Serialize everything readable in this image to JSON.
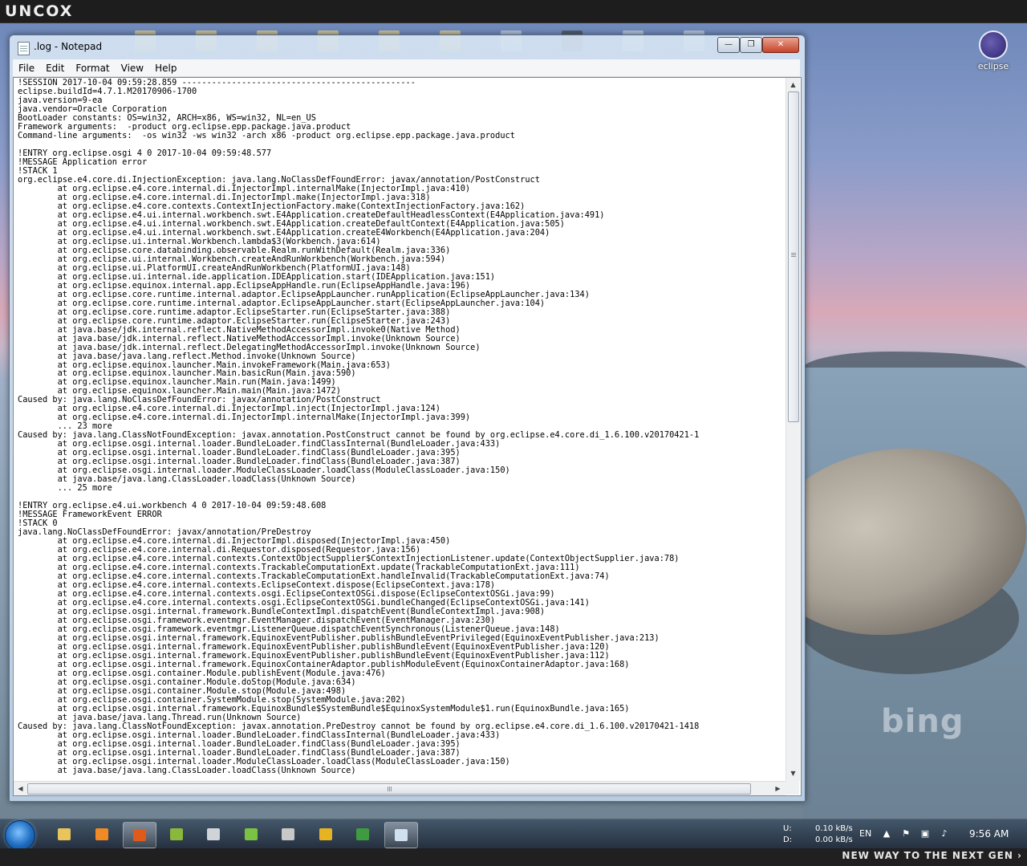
{
  "top_bar": {
    "brand": "UNCOX"
  },
  "bottom_bar": {
    "tagline": "NEW WAY TO THE NEXT GEN ›"
  },
  "desktop": {
    "eclipse_icon_label": "eclipse",
    "bing_watermark": "bing"
  },
  "window": {
    "title": ".log - Notepad",
    "buttons": {
      "minimize": "—",
      "maximize": "❐",
      "close": "✕"
    },
    "menu": [
      "File",
      "Edit",
      "Format",
      "View",
      "Help"
    ],
    "content": [
      "!SESSION 2017-10-04 09:59:28.859 -----------------------------------------------",
      "eclipse.buildId=4.7.1.M20170906-1700",
      "java.version=9-ea",
      "java.vendor=Oracle Corporation",
      "BootLoader constants: OS=win32, ARCH=x86, WS=win32, NL=en_US",
      "Framework arguments:  -product org.eclipse.epp.package.java.product",
      "Command-line arguments:  -os win32 -ws win32 -arch x86 -product org.eclipse.epp.package.java.product",
      "",
      "!ENTRY org.eclipse.osgi 4 0 2017-10-04 09:59:48.577",
      "!MESSAGE Application error",
      "!STACK 1",
      "org.eclipse.e4.core.di.InjectionException: java.lang.NoClassDefFoundError: javax/annotation/PostConstruct",
      "        at org.eclipse.e4.core.internal.di.InjectorImpl.internalMake(InjectorImpl.java:410)",
      "        at org.eclipse.e4.core.internal.di.InjectorImpl.make(InjectorImpl.java:318)",
      "        at org.eclipse.e4.core.contexts.ContextInjectionFactory.make(ContextInjectionFactory.java:162)",
      "        at org.eclipse.e4.ui.internal.workbench.swt.E4Application.createDefaultHeadlessContext(E4Application.java:491)",
      "        at org.eclipse.e4.ui.internal.workbench.swt.E4Application.createDefaultContext(E4Application.java:505)",
      "        at org.eclipse.e4.ui.internal.workbench.swt.E4Application.createE4Workbench(E4Application.java:204)",
      "        at org.eclipse.ui.internal.Workbench.lambda$3(Workbench.java:614)",
      "        at org.eclipse.core.databinding.observable.Realm.runWithDefault(Realm.java:336)",
      "        at org.eclipse.ui.internal.Workbench.createAndRunWorkbench(Workbench.java:594)",
      "        at org.eclipse.ui.PlatformUI.createAndRunWorkbench(PlatformUI.java:148)",
      "        at org.eclipse.ui.internal.ide.application.IDEApplication.start(IDEApplication.java:151)",
      "        at org.eclipse.equinox.internal.app.EclipseAppHandle.run(EclipseAppHandle.java:196)",
      "        at org.eclipse.core.runtime.internal.adaptor.EclipseAppLauncher.runApplication(EclipseAppLauncher.java:134)",
      "        at org.eclipse.core.runtime.internal.adaptor.EclipseAppLauncher.start(EclipseAppLauncher.java:104)",
      "        at org.eclipse.core.runtime.adaptor.EclipseStarter.run(EclipseStarter.java:388)",
      "        at org.eclipse.core.runtime.adaptor.EclipseStarter.run(EclipseStarter.java:243)",
      "        at java.base/jdk.internal.reflect.NativeMethodAccessorImpl.invoke0(Native Method)",
      "        at java.base/jdk.internal.reflect.NativeMethodAccessorImpl.invoke(Unknown Source)",
      "        at java.base/jdk.internal.reflect.DelegatingMethodAccessorImpl.invoke(Unknown Source)",
      "        at java.base/java.lang.reflect.Method.invoke(Unknown Source)",
      "        at org.eclipse.equinox.launcher.Main.invokeFramework(Main.java:653)",
      "        at org.eclipse.equinox.launcher.Main.basicRun(Main.java:590)",
      "        at org.eclipse.equinox.launcher.Main.run(Main.java:1499)",
      "        at org.eclipse.equinox.launcher.Main.main(Main.java:1472)",
      "Caused by: java.lang.NoClassDefFoundError: javax/annotation/PostConstruct",
      "        at org.eclipse.e4.core.internal.di.InjectorImpl.inject(InjectorImpl.java:124)",
      "        at org.eclipse.e4.core.internal.di.InjectorImpl.internalMake(InjectorImpl.java:399)",
      "        ... 23 more",
      "Caused by: java.lang.ClassNotFoundException: javax.annotation.PostConstruct cannot be found by org.eclipse.e4.core.di_1.6.100.v20170421-1",
      "        at org.eclipse.osgi.internal.loader.BundleLoader.findClassInternal(BundleLoader.java:433)",
      "        at org.eclipse.osgi.internal.loader.BundleLoader.findClass(BundleLoader.java:395)",
      "        at org.eclipse.osgi.internal.loader.BundleLoader.findClass(BundleLoader.java:387)",
      "        at org.eclipse.osgi.internal.loader.ModuleClassLoader.loadClass(ModuleClassLoader.java:150)",
      "        at java.base/java.lang.ClassLoader.loadClass(Unknown Source)",
      "        ... 25 more",
      "",
      "!ENTRY org.eclipse.e4.ui.workbench 4 0 2017-10-04 09:59:48.608",
      "!MESSAGE FrameworkEvent ERROR",
      "!STACK 0",
      "java.lang.NoClassDefFoundError: javax/annotation/PreDestroy",
      "        at org.eclipse.e4.core.internal.di.InjectorImpl.disposed(InjectorImpl.java:450)",
      "        at org.eclipse.e4.core.internal.di.Requestor.disposed(Requestor.java:156)",
      "        at org.eclipse.e4.core.internal.contexts.ContextObjectSupplier$ContextInjectionListener.update(ContextObjectSupplier.java:78)",
      "        at org.eclipse.e4.core.internal.contexts.TrackableComputationExt.update(TrackableComputationExt.java:111)",
      "        at org.eclipse.e4.core.internal.contexts.TrackableComputationExt.handleInvalid(TrackableComputationExt.java:74)",
      "        at org.eclipse.e4.core.internal.contexts.EclipseContext.dispose(EclipseContext.java:178)",
      "        at org.eclipse.e4.core.internal.contexts.osgi.EclipseContextOSGi.dispose(EclipseContextOSGi.java:99)",
      "        at org.eclipse.e4.core.internal.contexts.osgi.EclipseContextOSGi.bundleChanged(EclipseContextOSGi.java:141)",
      "        at org.eclipse.osgi.internal.framework.BundleContextImpl.dispatchEvent(BundleContextImpl.java:908)",
      "        at org.eclipse.osgi.framework.eventmgr.EventManager.dispatchEvent(EventManager.java:230)",
      "        at org.eclipse.osgi.framework.eventmgr.ListenerQueue.dispatchEventSynchronous(ListenerQueue.java:148)",
      "        at org.eclipse.osgi.internal.framework.EquinoxEventPublisher.publishBundleEventPrivileged(EquinoxEventPublisher.java:213)",
      "        at org.eclipse.osgi.internal.framework.EquinoxEventPublisher.publishBundleEvent(EquinoxEventPublisher.java:120)",
      "        at org.eclipse.osgi.internal.framework.EquinoxEventPublisher.publishBundleEvent(EquinoxEventPublisher.java:112)",
      "        at org.eclipse.osgi.internal.framework.EquinoxContainerAdaptor.publishModuleEvent(EquinoxContainerAdaptor.java:168)",
      "        at org.eclipse.osgi.container.Module.publishEvent(Module.java:476)",
      "        at org.eclipse.osgi.container.Module.doStop(Module.java:634)",
      "        at org.eclipse.osgi.container.Module.stop(Module.java:498)",
      "        at org.eclipse.osgi.container.SystemModule.stop(SystemModule.java:202)",
      "        at org.eclipse.osgi.internal.framework.EquinoxBundle$SystemBundle$EquinoxSystemModule$1.run(EquinoxBundle.java:165)",
      "        at java.base/java.lang.Thread.run(Unknown Source)",
      "Caused by: java.lang.ClassNotFoundException: javax.annotation.PreDestroy cannot be found by org.eclipse.e4.core.di_1.6.100.v20170421-1418",
      "        at org.eclipse.osgi.internal.loader.BundleLoader.findClassInternal(BundleLoader.java:433)",
      "        at org.eclipse.osgi.internal.loader.BundleLoader.findClass(BundleLoader.java:395)",
      "        at org.eclipse.osgi.internal.loader.BundleLoader.findClass(BundleLoader.java:387)",
      "        at org.eclipse.osgi.internal.loader.ModuleClassLoader.loadClass(ModuleClassLoader.java:150)",
      "        at java.base/java.lang.ClassLoader.loadClass(Unknown Source)"
    ]
  },
  "taskbar": {
    "apps": [
      {
        "name": "explorer",
        "icon": "folder-icon",
        "color": "#e8c45a",
        "active": false
      },
      {
        "name": "media-player",
        "icon": "play-icon",
        "color": "#f08a24",
        "active": false
      },
      {
        "name": "firefox",
        "icon": "firefox-icon",
        "color": "#e05a1a",
        "active": true
      },
      {
        "name": "tool",
        "icon": "tool-icon",
        "color": "#8ab83a",
        "active": false
      },
      {
        "name": "window",
        "icon": "window-icon",
        "color": "#d0d4d8",
        "active": false
      },
      {
        "name": "android",
        "icon": "android-icon",
        "color": "#7cc242",
        "active": false
      },
      {
        "name": "clapper",
        "icon": "clapper-icon",
        "color": "#c8c8c8",
        "active": false
      },
      {
        "name": "security",
        "icon": "shield-icon",
        "color": "#e6b422",
        "active": false
      },
      {
        "name": "globe",
        "icon": "globe-icon",
        "color": "#3f9b3f",
        "active": false
      },
      {
        "name": "notepad",
        "icon": "notepad-icon",
        "color": "#cfe0f0",
        "active": true
      }
    ],
    "tray": {
      "upload_label": "U:",
      "download_label": "D:",
      "upload_speed": "0.10 kB/s",
      "download_speed": "0.00 kB/s",
      "language": "EN",
      "clock": "9:56 AM"
    }
  }
}
